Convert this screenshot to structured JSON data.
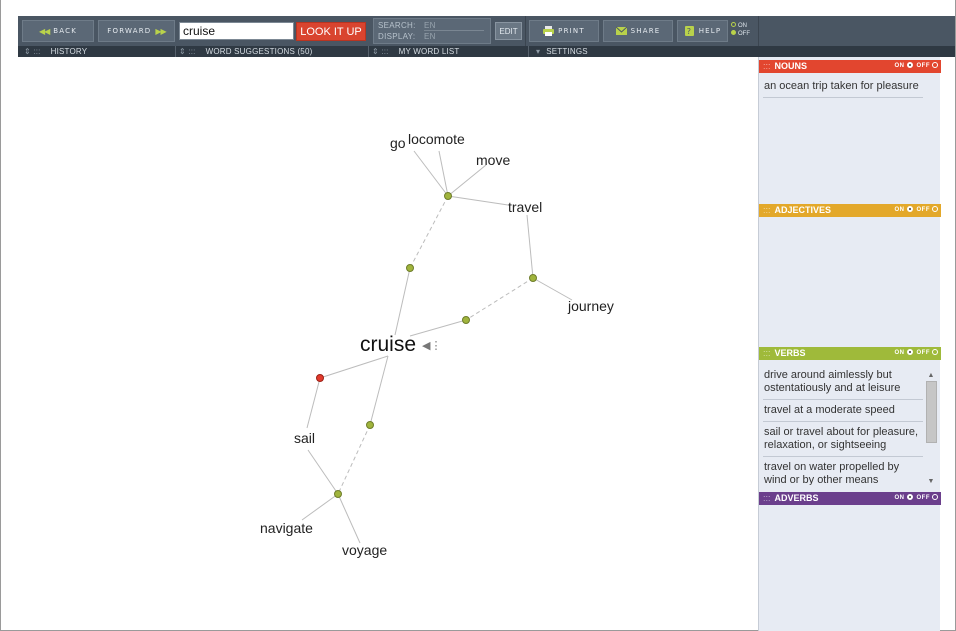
{
  "toolbar": {
    "back_label": "BACK",
    "forward_label": "FORWARD",
    "search_value": "cruise",
    "lookup_label": "LOOK IT UP",
    "search_lang_label": "SEARCH:",
    "search_lang_value": "EN",
    "display_lang_label": "DISPLAY:",
    "display_lang_value": "EN",
    "edit_label": "EDIT",
    "print_label": "PRINT",
    "share_label": "SHARE",
    "help_label": "HELP",
    "help_on": "ON",
    "help_off": "OFF"
  },
  "tabs": {
    "history": "HISTORY",
    "suggestions": "WORD SUGGESTIONS (50)",
    "wordlist": "MY WORD LIST",
    "settings": "SETTINGS"
  },
  "graph": {
    "main_word": "cruise",
    "words": {
      "go": "go",
      "locomote": "locomote",
      "move": "move",
      "travel": "travel",
      "journey": "journey",
      "sail": "sail",
      "navigate": "navigate",
      "voyage": "voyage"
    }
  },
  "panel": {
    "nouns": {
      "title": "NOUNS",
      "color": "#e2462f",
      "on": "ON",
      "off": "OFF",
      "senses": [
        "an ocean trip taken for pleasure"
      ]
    },
    "adjectives": {
      "title": "ADJECTIVES",
      "color": "#e3a82a",
      "on": "ON",
      "off": "OFF",
      "senses": []
    },
    "verbs": {
      "title": "VERBS",
      "color": "#9fba3a",
      "on": "ON",
      "off": "OFF",
      "senses": [
        "drive around aimlessly but ostentatiously and at leisure",
        "travel at a moderate speed",
        "sail or travel about for pleasure, relaxation, or sightseeing",
        "travel on water propelled by wind or by other means"
      ]
    },
    "adverbs": {
      "title": "ADVERBS",
      "color": "#6b3f8c",
      "on": "ON",
      "off": "OFF",
      "senses": []
    }
  }
}
